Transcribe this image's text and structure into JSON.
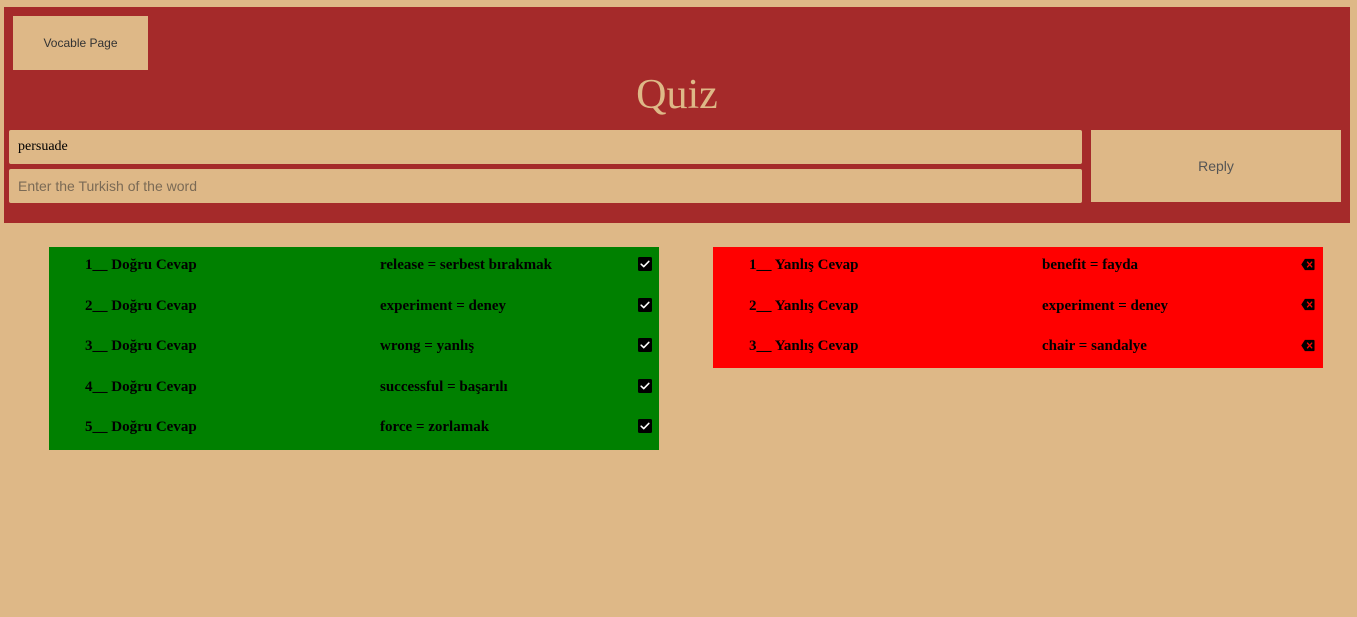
{
  "header": {
    "nav_label": "Vocable Page",
    "title": "Quiz"
  },
  "quiz": {
    "current_word": "persuade",
    "answer_value": "",
    "answer_placeholder": "Enter the Turkish of the word",
    "reply_label": "Reply"
  },
  "correct_answers": [
    {
      "label": "1__ Doğru Cevap",
      "pair": "release = serbest bırakmak"
    },
    {
      "label": "2__ Doğru Cevap",
      "pair": "experiment = deney"
    },
    {
      "label": "3__ Doğru Cevap",
      "pair": "wrong = yanlış"
    },
    {
      "label": "4__ Doğru Cevap",
      "pair": "successful = başarılı"
    },
    {
      "label": "5__ Doğru Cevap",
      "pair": "force = zorlamak"
    }
  ],
  "wrong_answers": [
    {
      "label": "1__ Yanlış Cevap",
      "pair": "benefit = fayda"
    },
    {
      "label": "2__ Yanlış Cevap",
      "pair": "experiment = deney"
    },
    {
      "label": "3__ Yanlış Cevap",
      "pair": "chair = sandalye"
    }
  ],
  "icons": {
    "correct_icon": "check-square-icon",
    "wrong_icon": "backspace-x-icon"
  },
  "colors": {
    "background": "#deb887",
    "header": "#a52a2a",
    "correct_panel": "#008000",
    "wrong_panel": "#ff0000"
  }
}
